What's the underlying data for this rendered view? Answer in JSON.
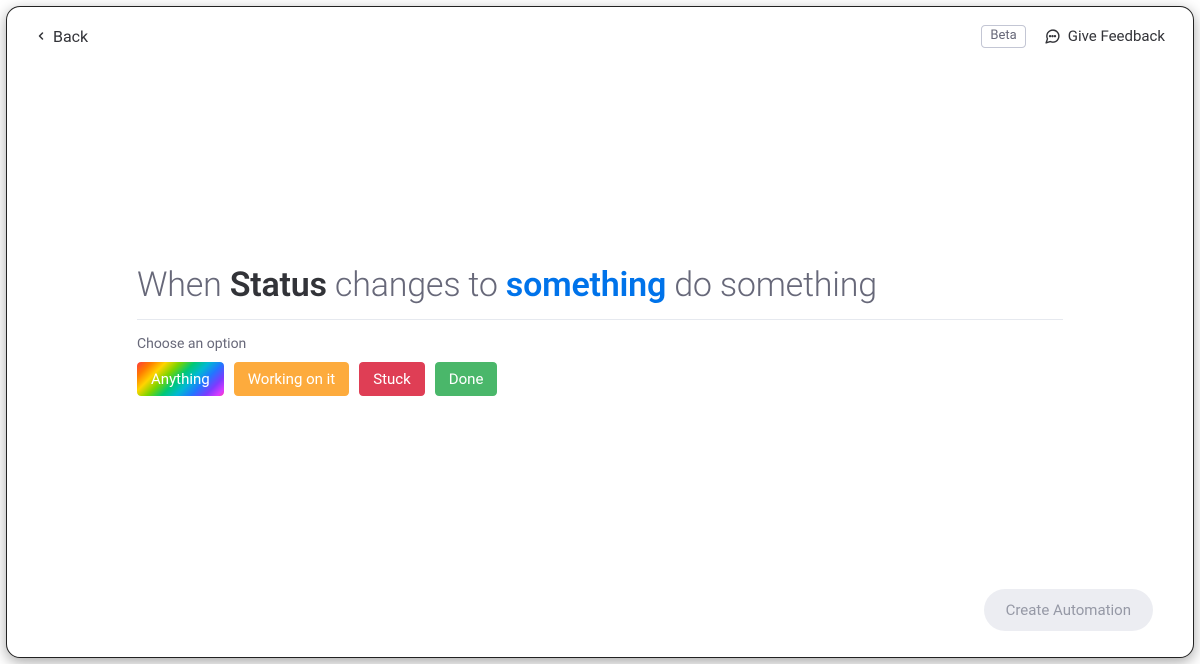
{
  "header": {
    "back_label": "Back",
    "beta_label": "Beta",
    "feedback_label": "Give Feedback"
  },
  "sentence": {
    "prefix": "When ",
    "column": "Status",
    "middle": " changes to ",
    "target": "something",
    "suffix": " do something"
  },
  "options": {
    "choose_label": "Choose an option",
    "items": [
      {
        "id": "anything",
        "label": "Anything",
        "style": "option-anything"
      },
      {
        "id": "working",
        "label": "Working on it",
        "style": "option-working"
      },
      {
        "id": "stuck",
        "label": "Stuck",
        "style": "option-stuck"
      },
      {
        "id": "done",
        "label": "Done",
        "style": "option-done"
      }
    ]
  },
  "footer": {
    "create_label": "Create Automation"
  }
}
